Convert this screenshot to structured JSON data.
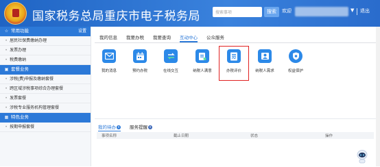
{
  "header": {
    "title": "国家税务总局重庆市电子税务局",
    "search_placeholder": "搜索事项",
    "search_btn": "搜索",
    "welcome": "欢迎",
    "caret": "▼",
    "logout": "退出",
    "bg_color": "#2d6fc4"
  },
  "sidebar": {
    "sections": [
      {
        "title": "常用功能",
        "icon": "star-icon",
        "extra": "设置",
        "items": [
          "居民社保费缴纳办理",
          "发票办理",
          "税费缴纳"
        ]
      },
      {
        "title": "套餐业务",
        "icon": "package-icon",
        "items": [
          "涉税(费)申报及缴纳套餐",
          "跨区域涉税事项综合办理套餐",
          "发票套餐",
          "涉税专业服务机构管理套餐"
        ]
      },
      {
        "title": "特色业务",
        "icon": "grid-icon",
        "items": [
          "按期申报套餐"
        ]
      }
    ]
  },
  "tabs": [
    "我的信息",
    "我要办税",
    "我要查询",
    "互动中心",
    "公众服务"
  ],
  "active_tab": "互动中心",
  "icons": [
    {
      "label": "我的消息",
      "icon": "mail-icon",
      "color": "#2c89e8"
    },
    {
      "label": "预约办税",
      "icon": "calendar-icon",
      "color": "#2c89e8"
    },
    {
      "label": "在线交互",
      "icon": "swap-icon",
      "color": "#2c89e8"
    },
    {
      "label": "纳税人满意",
      "icon": "survey-icon",
      "color": "#2c89e8"
    },
    {
      "label": "办税评价",
      "icon": "evaluation-icon",
      "color": "#2c89e8"
    },
    {
      "label": "纳税人需求",
      "icon": "person-icon",
      "color": "#2c89e8"
    },
    {
      "label": "权益保护",
      "icon": "shield-icon",
      "color": "#2c89e8"
    }
  ],
  "todo": {
    "tabs": [
      {
        "label": "我的待办",
        "count": "0"
      },
      {
        "label": "服务提醒",
        "count": "0"
      }
    ],
    "columns": [
      "事项名称",
      "截止日期",
      "状态",
      "操作"
    ]
  }
}
